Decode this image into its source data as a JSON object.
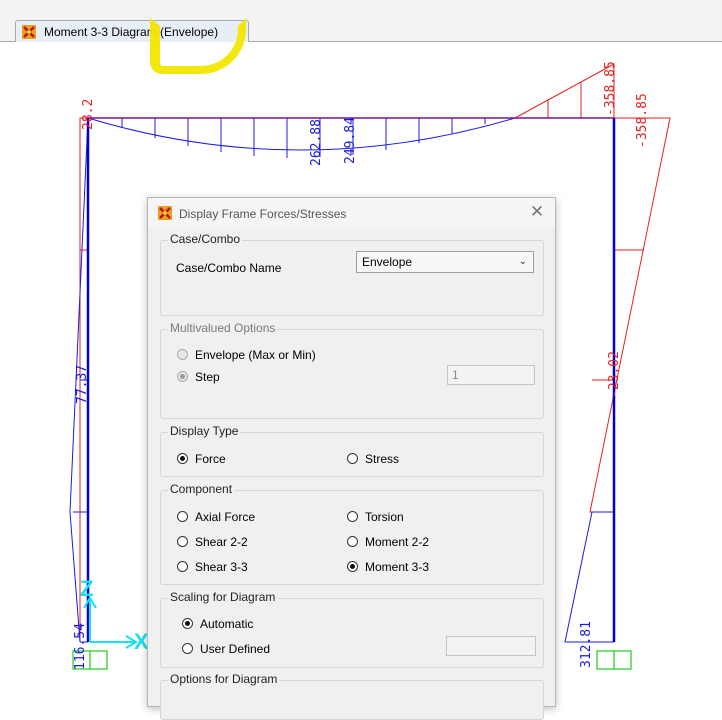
{
  "tab": {
    "title": "Moment 3-3 Diagram (Envelope)",
    "icon": "sap-app-icon"
  },
  "diagram": {
    "labels": {
      "top_left": "28.2",
      "mid_beam_1": "262.88",
      "mid_beam_2": "249.84",
      "top_right_1": "-358.85",
      "top_right_2": "-358.85",
      "left_column": "77.37",
      "right_column": "-23.02",
      "bottom_left": "116.54",
      "bottom_right": "312.81"
    },
    "axes": {
      "z": "Z",
      "x": "X"
    },
    "colors": {
      "positive": "#1a1ae6",
      "negative": "#e62222",
      "frame": "#0000c8",
      "axis": "#18e0f0",
      "support": "#22cc22"
    }
  },
  "dialog": {
    "title": "Display Frame Forces/Stresses",
    "case_combo": {
      "group_title": "Case/Combo",
      "name_label": "Case/Combo Name",
      "selected": "Envelope"
    },
    "multivalued": {
      "group_title": "Multivalued Options",
      "options": [
        "Envelope (Max or Min)",
        "Step"
      ],
      "step_value": "1"
    },
    "display_type": {
      "group_title": "Display Type",
      "force": "Force",
      "stress": "Stress"
    },
    "component": {
      "group_title": "Component",
      "axial": "Axial Force",
      "torsion": "Torsion",
      "shear22": "Shear 2-2",
      "moment22": "Moment 2-2",
      "shear33": "Shear 3-3",
      "moment33": "Moment 3-3"
    },
    "scaling": {
      "group_title": "Scaling for Diagram",
      "automatic": "Automatic",
      "user_defined": "User Defined"
    },
    "options": {
      "group_title": "Options for Diagram"
    }
  }
}
